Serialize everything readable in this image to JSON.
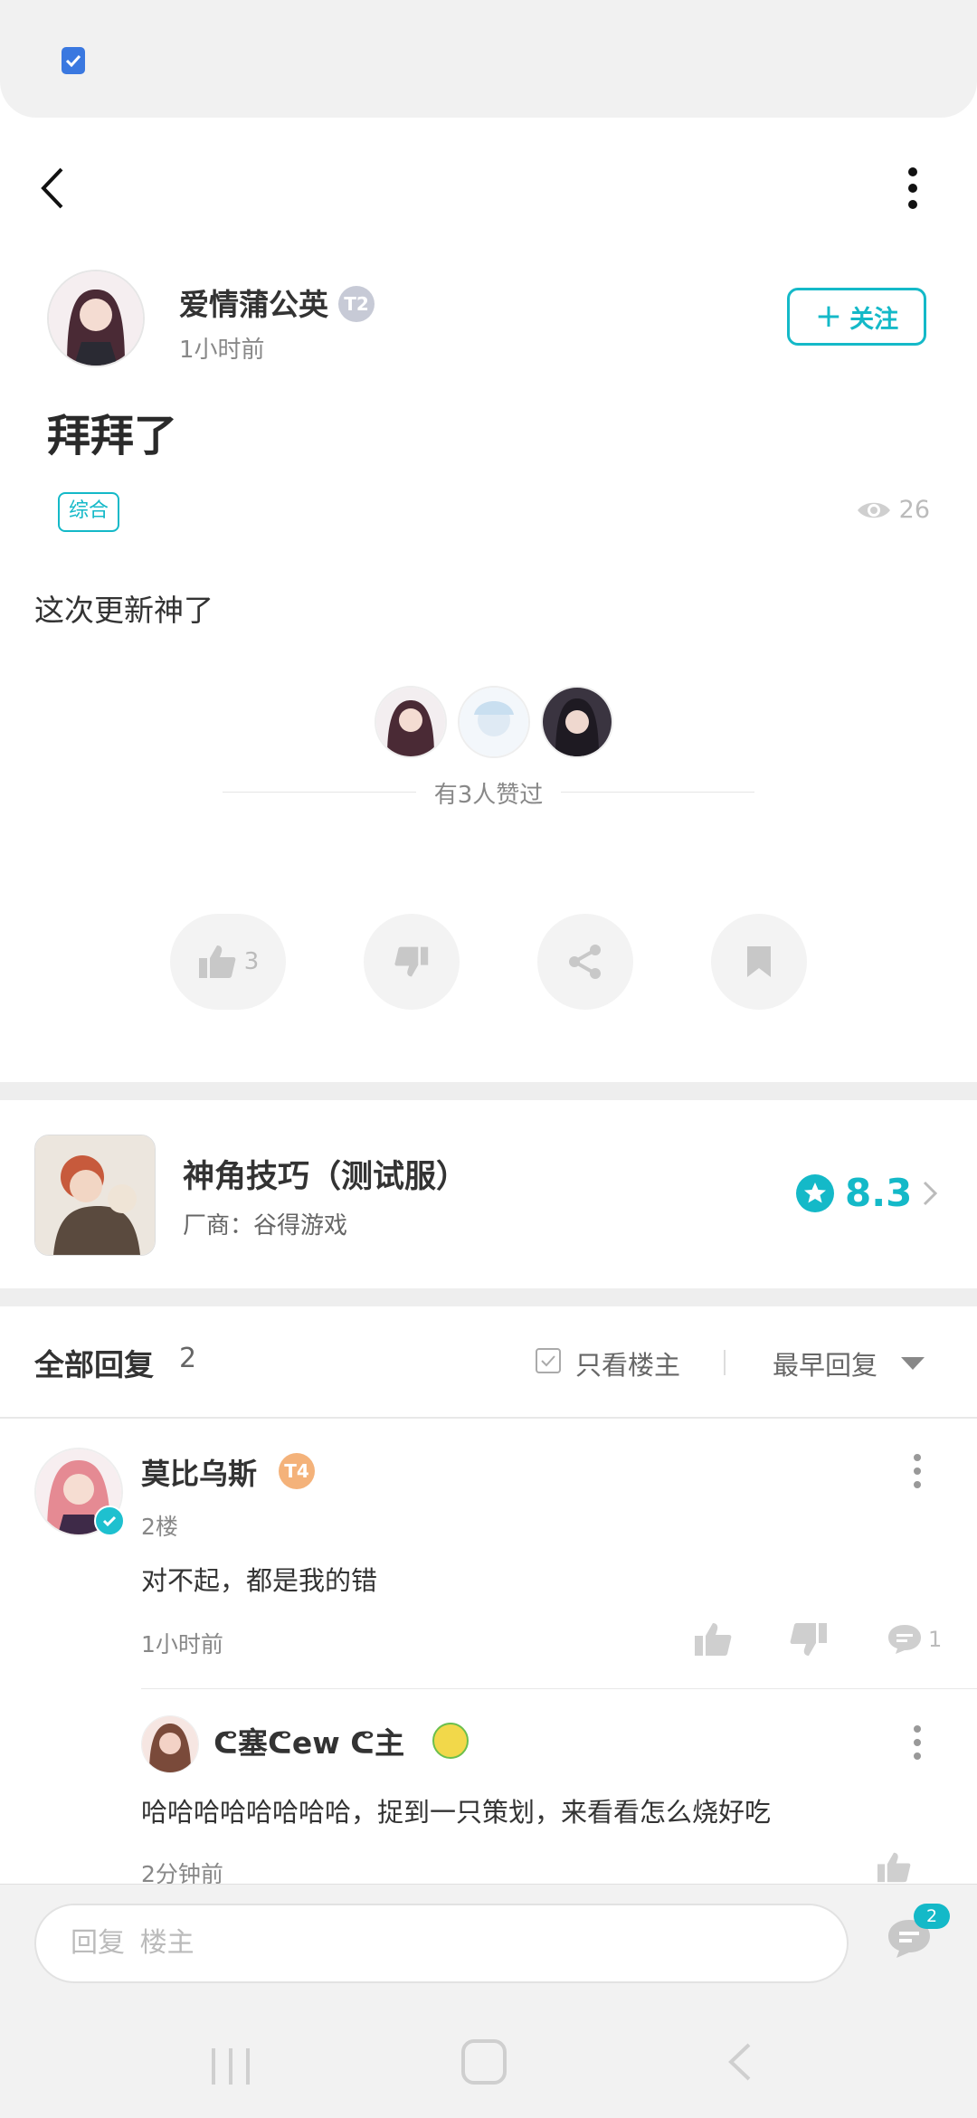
{
  "post": {
    "author": "爱情蒲公英",
    "author_level": "T2",
    "time": "1小时前",
    "follow_label": "关注",
    "title": "拜拜了",
    "tag": "综合",
    "views": "26",
    "body": "这次更新神了",
    "likers_text": "有3人赞过",
    "like_count": "3"
  },
  "game": {
    "name": "神角技巧（测试服）",
    "vendor": "厂商：谷得游戏",
    "rating": "8.3"
  },
  "replies": {
    "header": "全部回复",
    "count": "2",
    "only_owner_label": "只看楼主",
    "sort_label": "最早回复"
  },
  "comment": {
    "name": "莫比乌斯",
    "level": "T4",
    "floor": "2楼",
    "text": "对不起，都是我的错",
    "time": "1小时前",
    "comment_count": "1",
    "reply": {
      "name": "ᕦ塞ᕦew ᕦ主",
      "text": "哈哈哈哈哈哈哈哈，捉到一只策划，来看看怎么烧好吃",
      "time": "2分钟前"
    }
  },
  "composer": {
    "placeholder": "回复  楼主",
    "badge": "2"
  },
  "colors": {
    "accent": "#14b9c8",
    "divider": "#eeeeee"
  }
}
